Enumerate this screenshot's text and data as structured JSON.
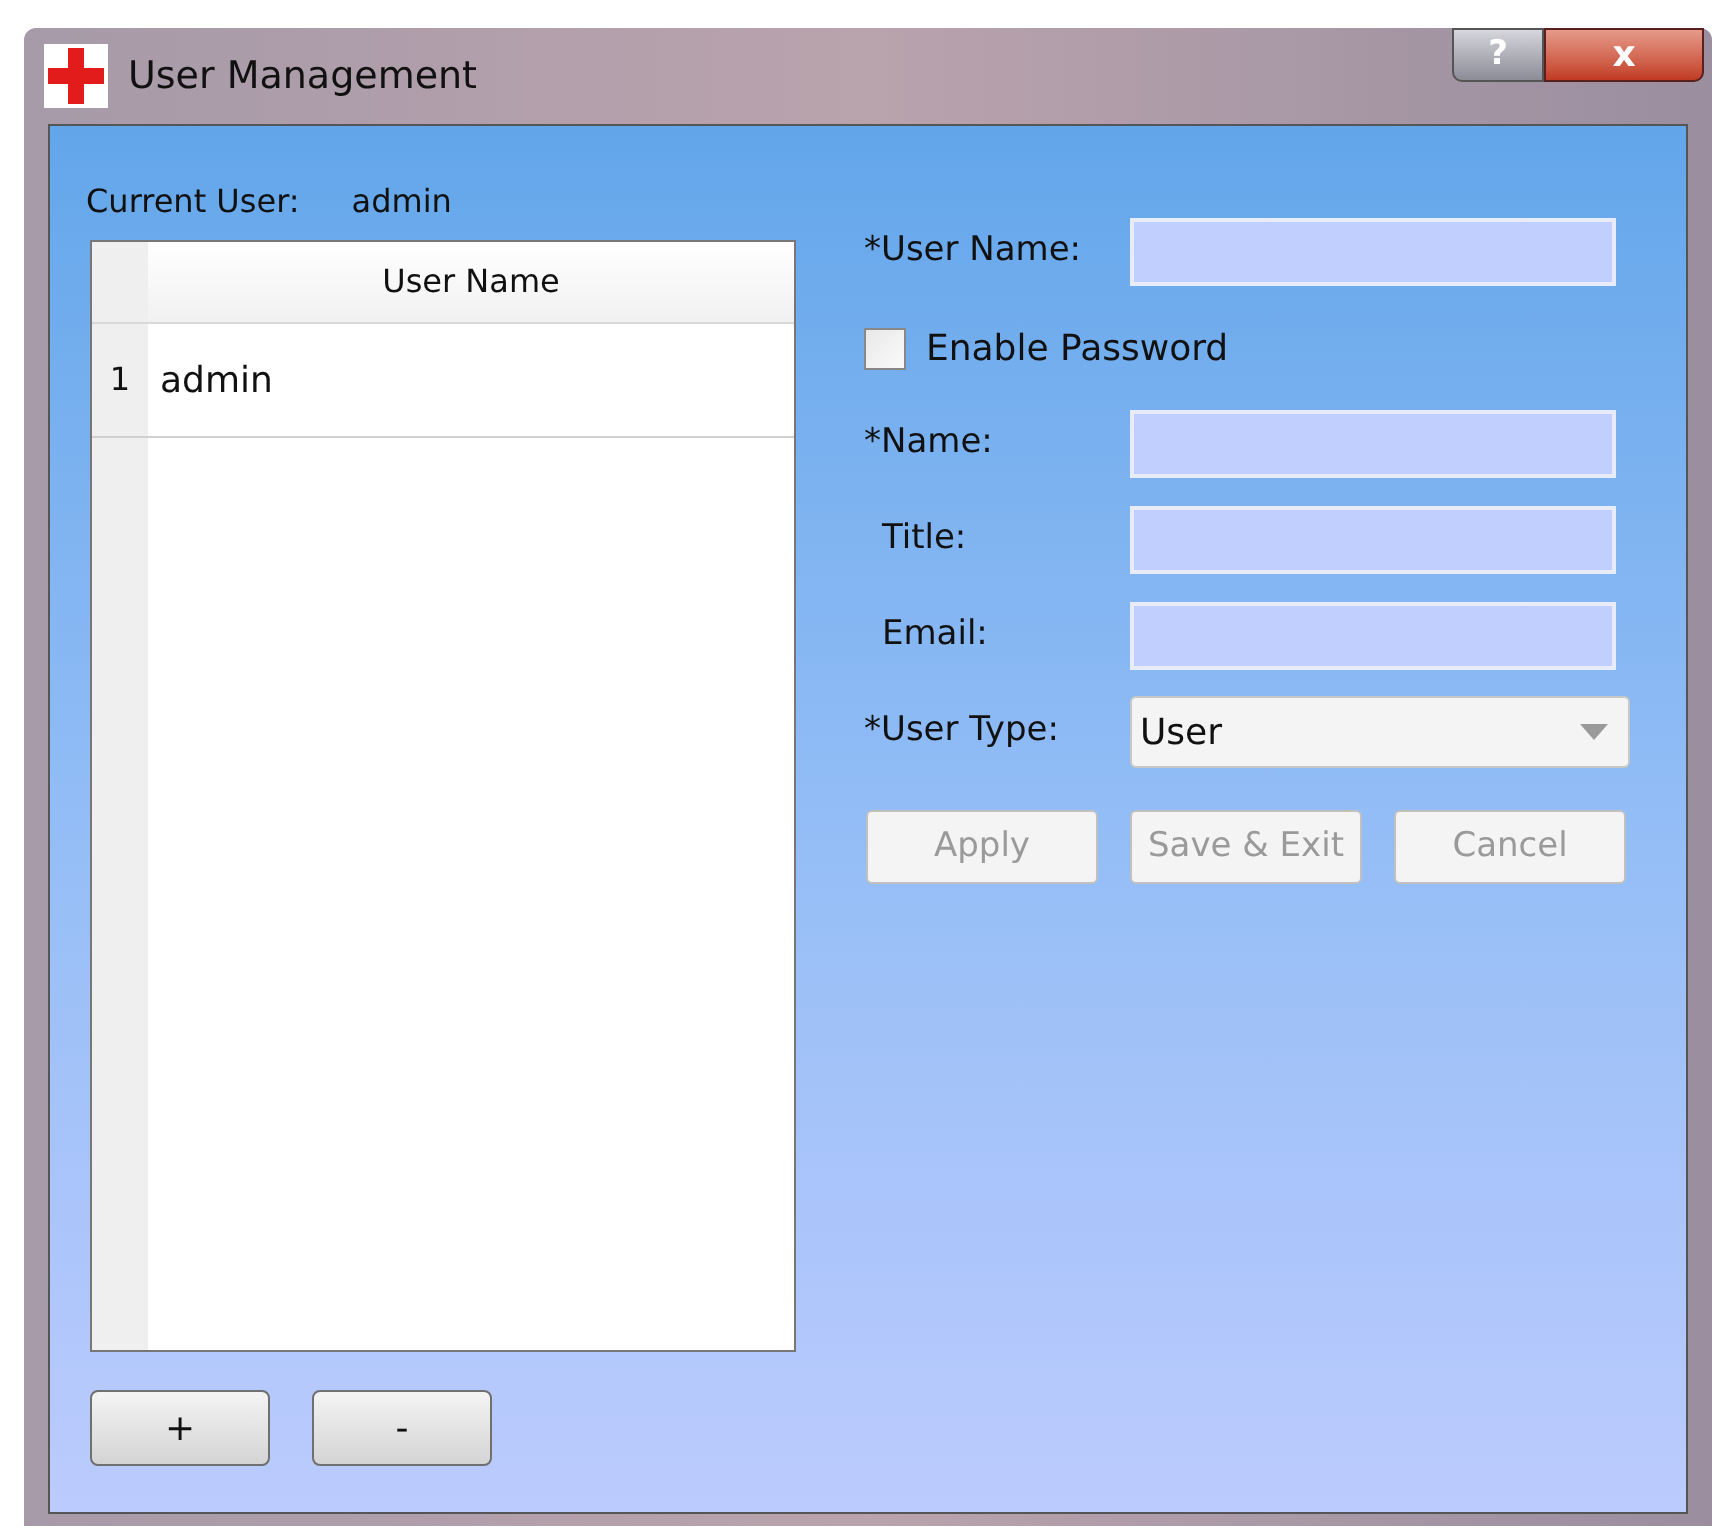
{
  "window": {
    "title": "User Management",
    "help_button": "?",
    "close_button": "x"
  },
  "current_user": {
    "label": "Current User:",
    "value": "admin"
  },
  "table": {
    "columns": [
      "User Name"
    ],
    "rows": [
      {
        "number": "1",
        "cells": [
          "admin"
        ],
        "selected": false
      }
    ]
  },
  "list_buttons": [
    "+",
    "-"
  ],
  "form": {
    "fields": [
      {
        "kind": "text",
        "label": "*User Name:"
      },
      {
        "kind": "checkbox",
        "label": "Enable Password",
        "checked": false
      },
      {
        "kind": "text",
        "label": "*Name:"
      },
      {
        "kind": "text",
        "label": "Title:"
      },
      {
        "kind": "text",
        "label": "Email:"
      },
      {
        "kind": "select",
        "label": "*User Type:",
        "value": "User"
      }
    ]
  },
  "buttons": [
    {
      "label": "Apply",
      "disabled": true
    },
    {
      "label": "Save & Exit",
      "disabled": true
    },
    {
      "label": "Cancel",
      "disabled": true
    }
  ]
}
